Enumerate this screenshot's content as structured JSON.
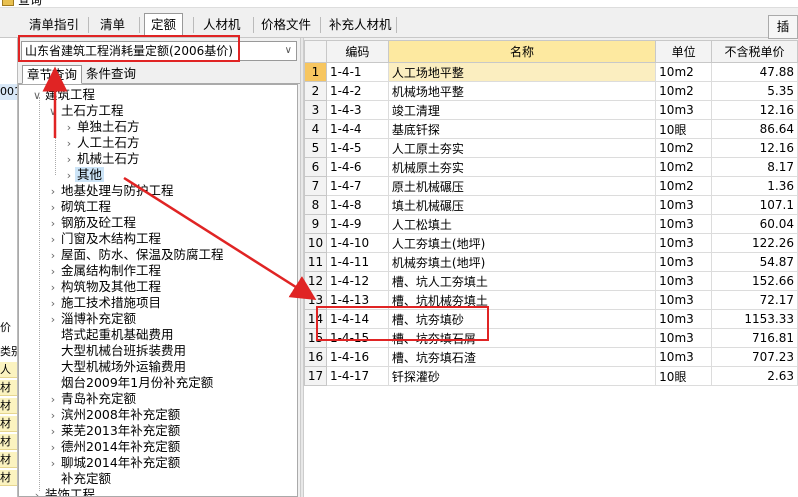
{
  "window": {
    "title": "查询"
  },
  "tabs": [
    {
      "label": "清单指引"
    },
    {
      "label": "清单"
    },
    {
      "label": "定额"
    },
    {
      "label": "人材机"
    },
    {
      "label": "价格文件"
    },
    {
      "label": "补充人材机"
    }
  ],
  "insert_label": "插",
  "left_strip": {
    "cells": [
      "001",
      "价",
      "类别",
      "人",
      "材",
      "材",
      "材",
      "材",
      "材",
      "材"
    ]
  },
  "quota_select": {
    "value": "山东省建筑工程消耗量定额(2006基价)"
  },
  "subtabs": [
    {
      "label": "章节查询"
    },
    {
      "label": "条件查询"
    }
  ],
  "tree": [
    {
      "label": "建筑工程"
    },
    {
      "label": "土石方工程"
    },
    {
      "label": "单独土石方"
    },
    {
      "label": "人工土石方"
    },
    {
      "label": "机械土石方"
    },
    {
      "label": "其他"
    },
    {
      "label": "地基处理与防护工程"
    },
    {
      "label": "砌筑工程"
    },
    {
      "label": "钢筋及砼工程"
    },
    {
      "label": "门窗及木结构工程"
    },
    {
      "label": "屋面、防水、保温及防腐工程"
    },
    {
      "label": "金属结构制作工程"
    },
    {
      "label": "构筑物及其他工程"
    },
    {
      "label": "施工技术措施项目"
    },
    {
      "label": "淄博补充定额"
    },
    {
      "label": "塔式起重机基础费用"
    },
    {
      "label": "大型机械台班拆装费用"
    },
    {
      "label": "大型机械场外运输费用"
    },
    {
      "label": "烟台2009年1月份补充定额"
    },
    {
      "label": "青岛补充定额"
    },
    {
      "label": "滨州2008年补充定额"
    },
    {
      "label": "莱芜2013年补充定额"
    },
    {
      "label": "德州2014年补充定额"
    },
    {
      "label": "聊城2014年补充定额"
    },
    {
      "label": "补充定额"
    },
    {
      "label": "装饰工程"
    }
  ],
  "table": {
    "headers": {
      "code": "编码",
      "name": "名称",
      "unit": "单位",
      "price": "不含税单价"
    },
    "rows": [
      {
        "no": "1",
        "code": "1-4-1",
        "name": "人工场地平整",
        "unit": "10m2",
        "price": "47.88"
      },
      {
        "no": "2",
        "code": "1-4-2",
        "name": "机械场地平整",
        "unit": "10m2",
        "price": "5.35"
      },
      {
        "no": "3",
        "code": "1-4-3",
        "name": "竣工清理",
        "unit": "10m3",
        "price": "12.16"
      },
      {
        "no": "4",
        "code": "1-4-4",
        "name": "基底钎探",
        "unit": "10眼",
        "price": "86.64"
      },
      {
        "no": "5",
        "code": "1-4-5",
        "name": "人工原土夯实",
        "unit": "10m2",
        "price": "12.16"
      },
      {
        "no": "6",
        "code": "1-4-6",
        "name": "机械原土夯实",
        "unit": "10m2",
        "price": "8.17"
      },
      {
        "no": "7",
        "code": "1-4-7",
        "name": "原土机械碾压",
        "unit": "10m2",
        "price": "1.36"
      },
      {
        "no": "8",
        "code": "1-4-8",
        "name": "填土机械碾压",
        "unit": "10m3",
        "price": "107.1"
      },
      {
        "no": "9",
        "code": "1-4-9",
        "name": "人工松填土",
        "unit": "10m3",
        "price": "60.04"
      },
      {
        "no": "10",
        "code": "1-4-10",
        "name": "人工夯填土(地坪)",
        "unit": "10m3",
        "price": "122.26"
      },
      {
        "no": "11",
        "code": "1-4-11",
        "name": "机械夯填土(地坪)",
        "unit": "10m3",
        "price": "54.87"
      },
      {
        "no": "12",
        "code": "1-4-12",
        "name": "槽、坑人工夯填土",
        "unit": "10m3",
        "price": "152.66"
      },
      {
        "no": "13",
        "code": "1-4-13",
        "name": "槽、坑机械夯填土",
        "unit": "10m3",
        "price": "72.17"
      },
      {
        "no": "14",
        "code": "1-4-14",
        "name": "槽、坑夯填砂",
        "unit": "10m3",
        "price": "1153.33"
      },
      {
        "no": "15",
        "code": "1-4-15",
        "name": "槽、坑夯填石屑",
        "unit": "10m3",
        "price": "716.81"
      },
      {
        "no": "16",
        "code": "1-4-16",
        "name": "槽、坑夯填石渣",
        "unit": "10m3",
        "price": "707.23"
      },
      {
        "no": "17",
        "code": "1-4-17",
        "name": "钎探灌砂",
        "unit": "10眼",
        "price": "2.63"
      }
    ]
  },
  "colors": {
    "annotation": "#e02424",
    "selected_row_number": "#f7c660",
    "name_header": "#fde9a0"
  }
}
